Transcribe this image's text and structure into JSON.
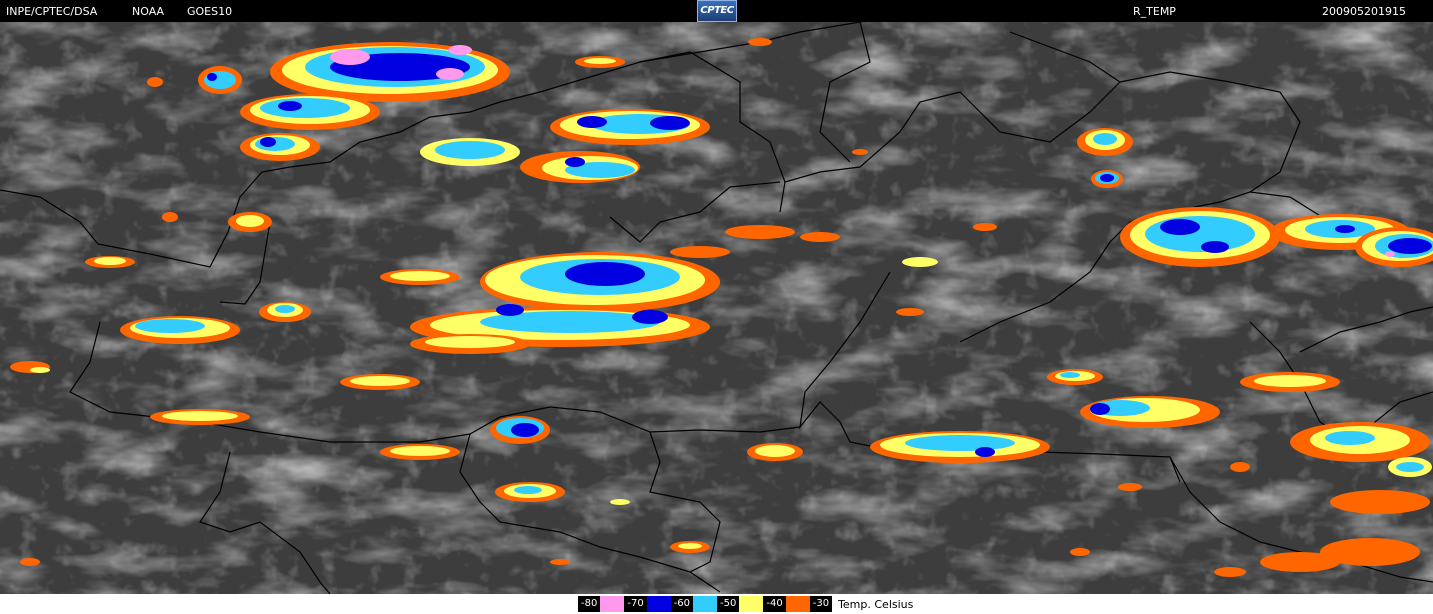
{
  "header": {
    "source": "INPE/CPTEC/DSA",
    "agency": "NOAA",
    "satellite": "GOES10",
    "logo_text": "CPTEC",
    "product": "R_TEMP",
    "timestamp": "200905201915"
  },
  "legend": {
    "unit": "Temp. Celsius",
    "steps": [
      {
        "label": "-80",
        "color": "#ff99ee"
      },
      {
        "label": "-70",
        "color": "#0000e0"
      },
      {
        "label": "-60",
        "color": "#33ccff"
      },
      {
        "label": "-50",
        "color": "#ffff66"
      },
      {
        "label": "-40",
        "color": "#ff6600"
      },
      {
        "label": "-30",
        "color": "#ff6600"
      }
    ]
  },
  "colors": {
    "background": "#3c3c3c",
    "border": "#000000",
    "cloud": "#cfcfcf",
    "orange": "#ff6600",
    "yellow": "#ffff66",
    "cyan": "#33ccff",
    "blue": "#0000e0",
    "pink": "#ff99ee"
  }
}
